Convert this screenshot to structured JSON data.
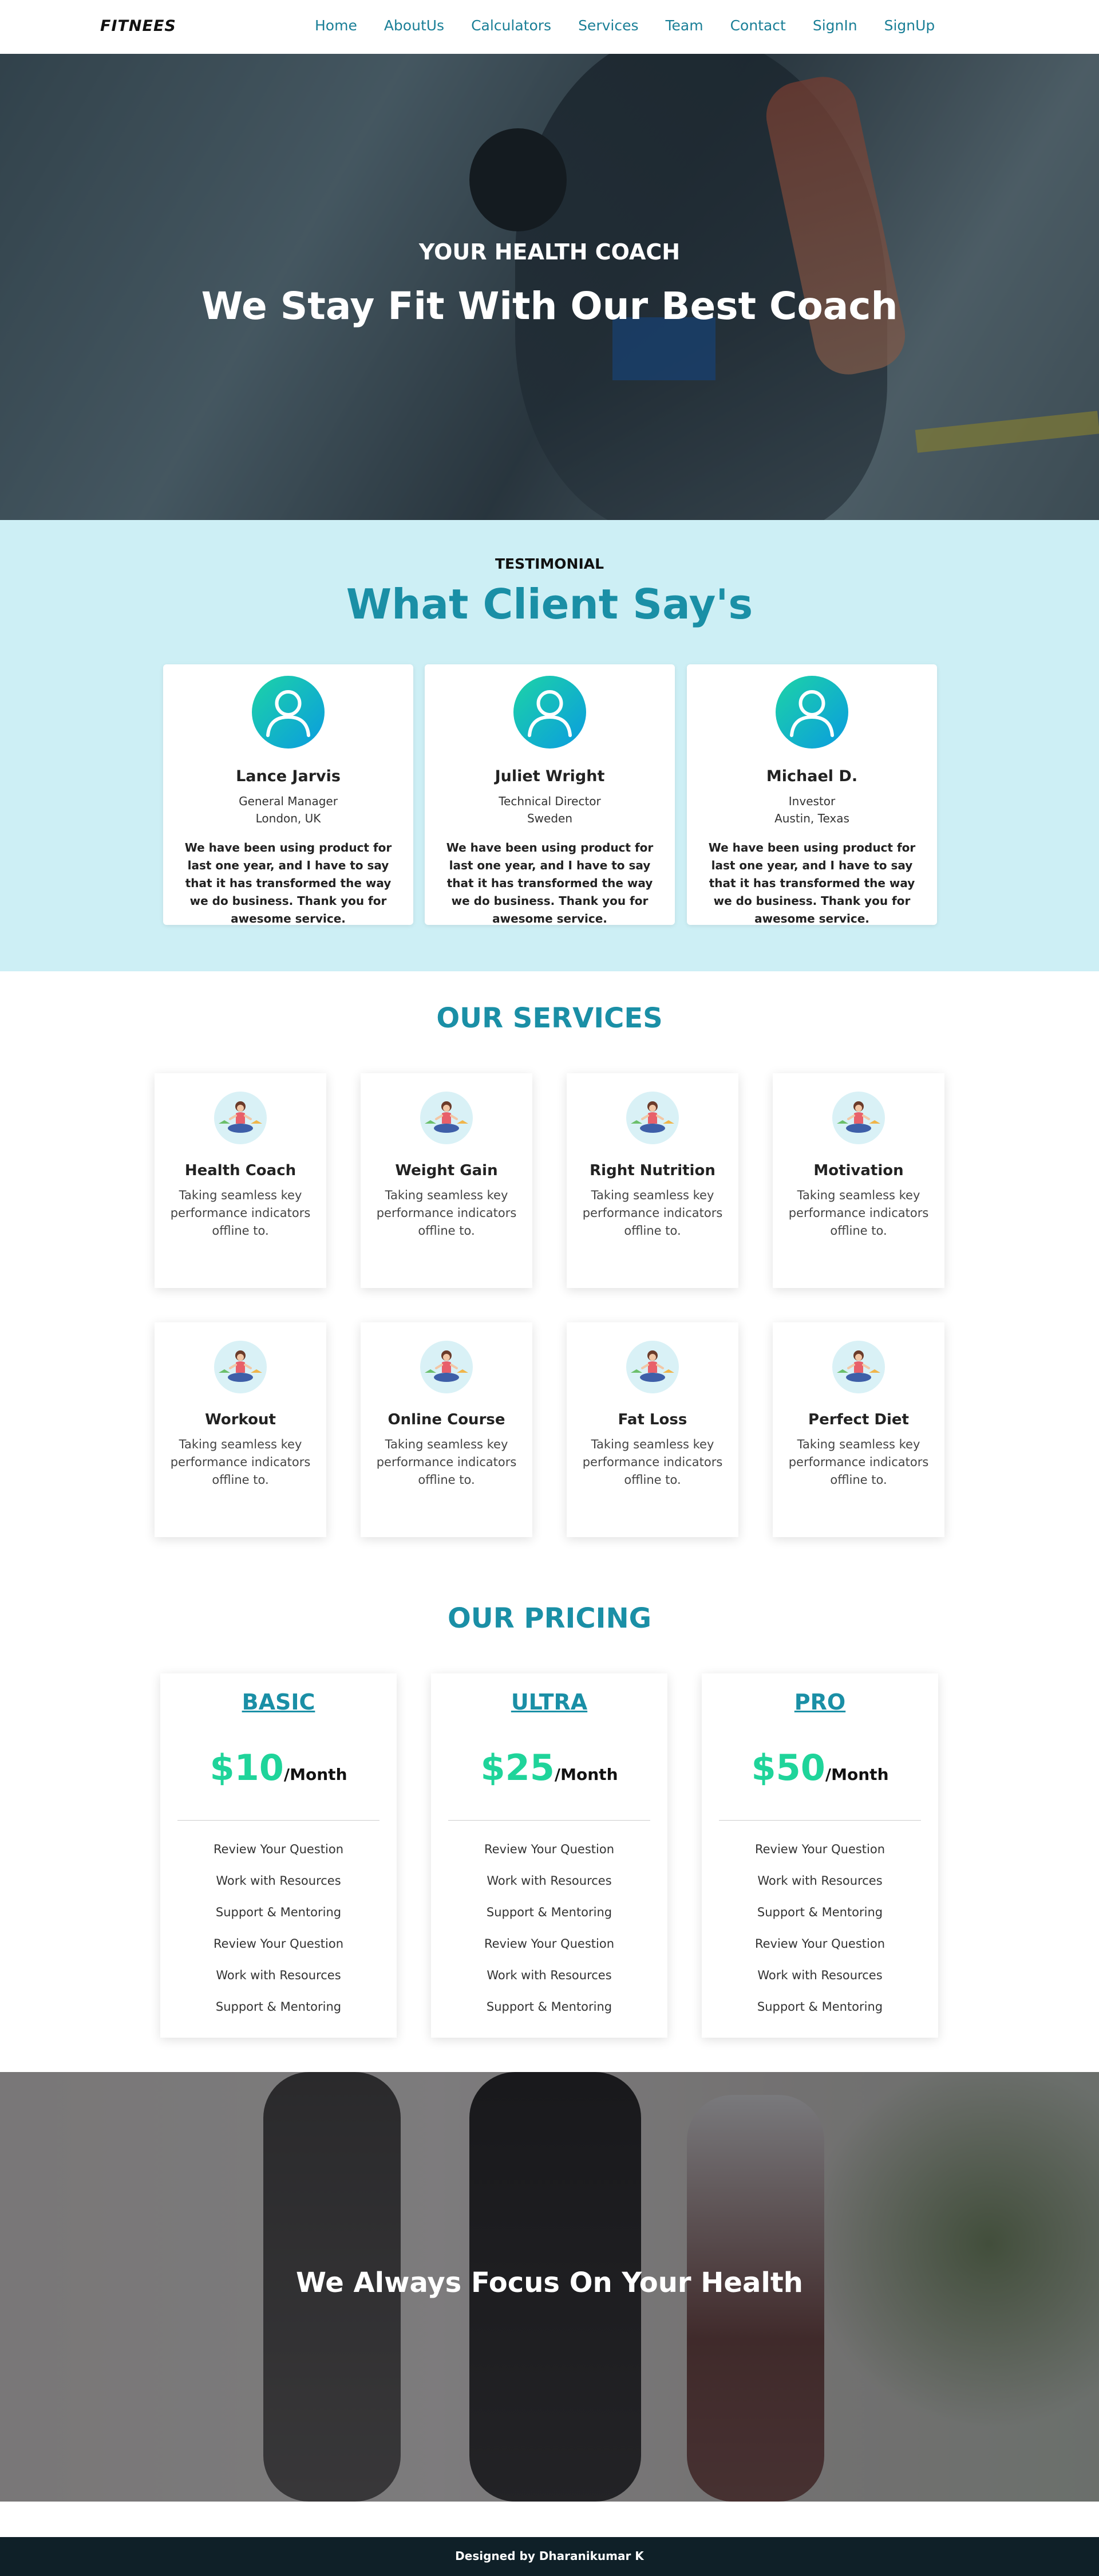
{
  "nav": {
    "logo": "FITNEES",
    "links": [
      "Home",
      "AboutUs",
      "Calculators",
      "Services",
      "Team",
      "Contact",
      "SignIn",
      "SignUp"
    ]
  },
  "hero": {
    "subtitle": "YOUR HEALTH COACH",
    "title": "We Stay Fit With Our Best Coach"
  },
  "testimonial": {
    "label": "TESTIMONIAL",
    "title": "What Client Say's",
    "items": [
      {
        "name": "Lance Jarvis",
        "role": "General Manager",
        "location": "London, UK",
        "quote": "We have been using product for last one year, and I have to say that it has transformed the way we do business. Thank you for awesome service.",
        "icon": "user-icon"
      },
      {
        "name": "Juliet Wright",
        "role": "Technical Director",
        "location": "Sweden",
        "quote": "We have been using product for last one year, and I have to say that it has transformed the way we do business. Thank you for awesome service.",
        "icon": "user-icon"
      },
      {
        "name": "Michael D.",
        "role": "Investor",
        "location": "Austin, Texas",
        "quote": "We have been using product for last one year, and I have to say that it has transformed the way we do business. Thank you for awesome service.",
        "icon": "user-icon"
      }
    ]
  },
  "services": {
    "title": "OUR SERVICES",
    "items": [
      {
        "name": "Health Coach",
        "desc": "Taking seamless key performance indicators offline to.",
        "icon": "yoga-woman-icon"
      },
      {
        "name": "Weight Gain",
        "desc": "Taking seamless key performance indicators offline to.",
        "icon": "yoga-woman-icon"
      },
      {
        "name": "Right Nutrition",
        "desc": "Taking seamless key performance indicators offline to.",
        "icon": "yoga-woman-icon"
      },
      {
        "name": "Motivation",
        "desc": "Taking seamless key performance indicators offline to.",
        "icon": "yoga-woman-icon"
      },
      {
        "name": "Workout",
        "desc": "Taking seamless key performance indicators offline to.",
        "icon": "yoga-woman-icon"
      },
      {
        "name": "Online Course",
        "desc": "Taking seamless key performance indicators offline to.",
        "icon": "yoga-woman-icon"
      },
      {
        "name": "Fat Loss",
        "desc": "Taking seamless key performance indicators offline to.",
        "icon": "yoga-woman-icon"
      },
      {
        "name": "Perfect Diet",
        "desc": "Taking seamless key performance indicators offline to.",
        "icon": "yoga-woman-icon"
      }
    ]
  },
  "pricing": {
    "title": "OUR PRICING",
    "plans": [
      {
        "name": "BASIC",
        "price": "$10",
        "period": "/Month",
        "features": [
          "Review Your Question",
          "Work with Resources",
          "Support & Mentoring",
          "Review Your Question",
          "Work with Resources",
          "Support & Mentoring"
        ]
      },
      {
        "name": "ULTRA",
        "price": "$25",
        "period": "/Month",
        "features": [
          "Review Your Question",
          "Work with Resources",
          "Support & Mentoring",
          "Review Your Question",
          "Work with Resources",
          "Support & Mentoring"
        ]
      },
      {
        "name": "PRO",
        "price": "$50",
        "period": "/Month",
        "features": [
          "Review Your Question",
          "Work with Resources",
          "Support & Mentoring",
          "Review Your Question",
          "Work with Resources",
          "Support & Mentoring"
        ]
      }
    ]
  },
  "focus": {
    "title": "We Always Focus On Your Health"
  },
  "footer": {
    "text": "Designed by Dharanikumar K"
  },
  "colors": {
    "accent": "#1a8fa6",
    "price_green": "#1fd49a",
    "testimonial_bg": "#cdeff5",
    "footer_bg": "#0f2028"
  }
}
